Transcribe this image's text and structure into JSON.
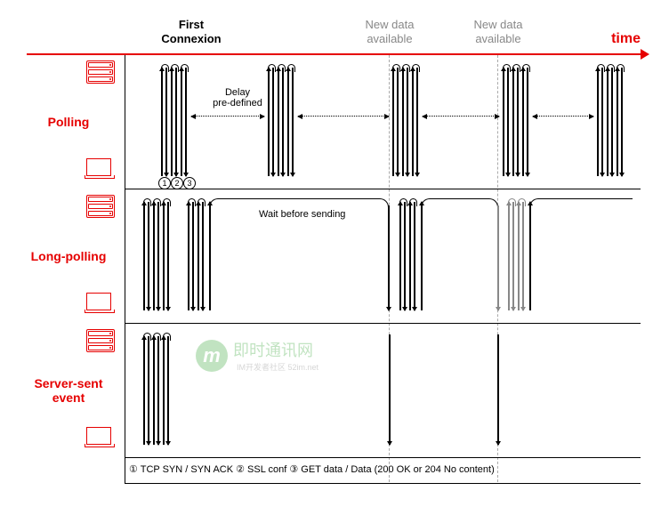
{
  "header": {
    "first_connexion_l1": "First",
    "first_connexion_l2": "Connexion",
    "new_data_1_l1": "New data",
    "new_data_1_l2": "available",
    "new_data_2_l1": "New data",
    "new_data_2_l2": "available",
    "time_label": "time"
  },
  "rows": {
    "polling": "Polling",
    "long_polling": "Long-polling",
    "sse_l1": "Server-sent",
    "sse_l2": "event"
  },
  "annotations": {
    "delay_l1": "Delay",
    "delay_l2": "pre-defined",
    "wait": "Wait before sending",
    "step1": "1",
    "step2": "2",
    "step3": "3"
  },
  "legend": {
    "s1": "①",
    "t1": " TCP SYN / SYN ACK ",
    "s2": "②",
    "t2": " SSL conf ",
    "s3": "③",
    "t3": " GET data / Data (200 OK or 204 No content)"
  },
  "watermark": {
    "badge": "m",
    "title": "即时通讯网",
    "sub": "IM开发者社区  52im.net"
  },
  "chart_data": {
    "type": "timeline-diagram",
    "axis": "time (left→right)",
    "events": [
      "First Connexion",
      "New data available #1",
      "New data available #2"
    ],
    "techniques": [
      {
        "name": "Polling",
        "pattern": "client repeatedly performs full request cycle (①TCP SYN/SYN ACK ②SSL conf ③GET data) at a fixed pre-defined delay, regardless of whether new data is available",
        "bursts": 5,
        "requests_per_burst": 3
      },
      {
        "name": "Long-polling",
        "pattern": "client performs request cycle; server holds the connection open ('Wait before sending') until new data is available, then responds; client immediately reconnects",
        "waits": [
          "until event #1",
          "until event #2",
          "ongoing"
        ]
      },
      {
        "name": "Server-sent event",
        "pattern": "single initial request cycle establishes a persistent connection; server pushes data to client each time new data becomes available without reconnecting",
        "initial_bursts": 1,
        "pushes": 2
      }
    ],
    "legend": {
      "①": "TCP SYN / SYN ACK",
      "②": "SSL conf",
      "③": "GET data / Data (200 OK or 204 No content)"
    }
  }
}
